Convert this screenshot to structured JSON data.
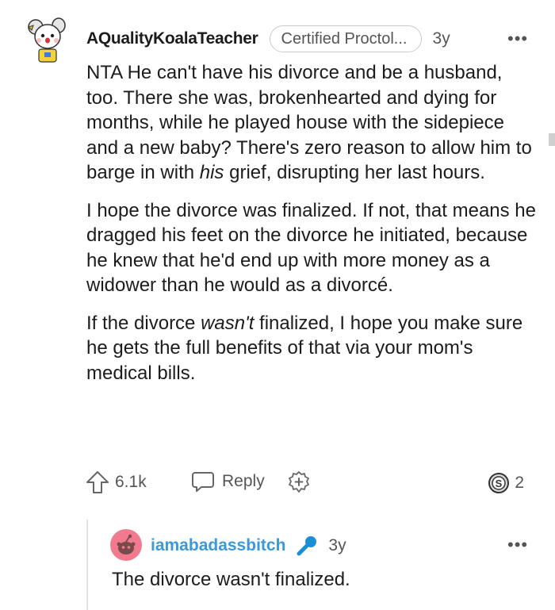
{
  "comment": {
    "username": "AQualityKoalaTeacher",
    "flair": "Certified Proctol...",
    "age": "3y",
    "paragraphs": [
      {
        "before": "NTA He can't have his divorce and be a husband, too. There she was, brokenhearted and dying for months, while he played house with the sidepiece and a new baby? There's zero reason to allow him to barge in with ",
        "italic": "his",
        "after": " grief, disrupting her last hours."
      },
      {
        "before": "I hope the divorce was finalized. If not, that means he dragged his feet on the divorce he initiated, because he knew that he'd end up with more money as a widower than he would as a divorcé.",
        "italic": "",
        "after": ""
      },
      {
        "before": "If the divorce ",
        "italic": "wasn't",
        "after": " finalized, I hope you make sure he gets the full benefits of that via your mom's medical bills."
      }
    ],
    "actions": {
      "upvotes": "6.1k",
      "reply_label": "Reply",
      "award_count": "2"
    },
    "icons": [
      "koala-avatar-icon",
      "more-options-icon",
      "upvote-arrow-icon",
      "reply-bubble-icon",
      "add-award-icon",
      "silver-award-icon"
    ]
  },
  "reply": {
    "username": "iamabadassbitch",
    "age": "3y",
    "body": "The divorce wasn't finalized.",
    "icons": [
      "snoo-avatar-icon",
      "microphone-flair-icon",
      "more-options-icon"
    ]
  },
  "colors": {
    "text": "#1c1c1c",
    "muted": "#555555",
    "reply_username": "#3a9ad9",
    "thread_line": "#e4e4e4",
    "reply_avatar_bg": "#f27a8f"
  }
}
